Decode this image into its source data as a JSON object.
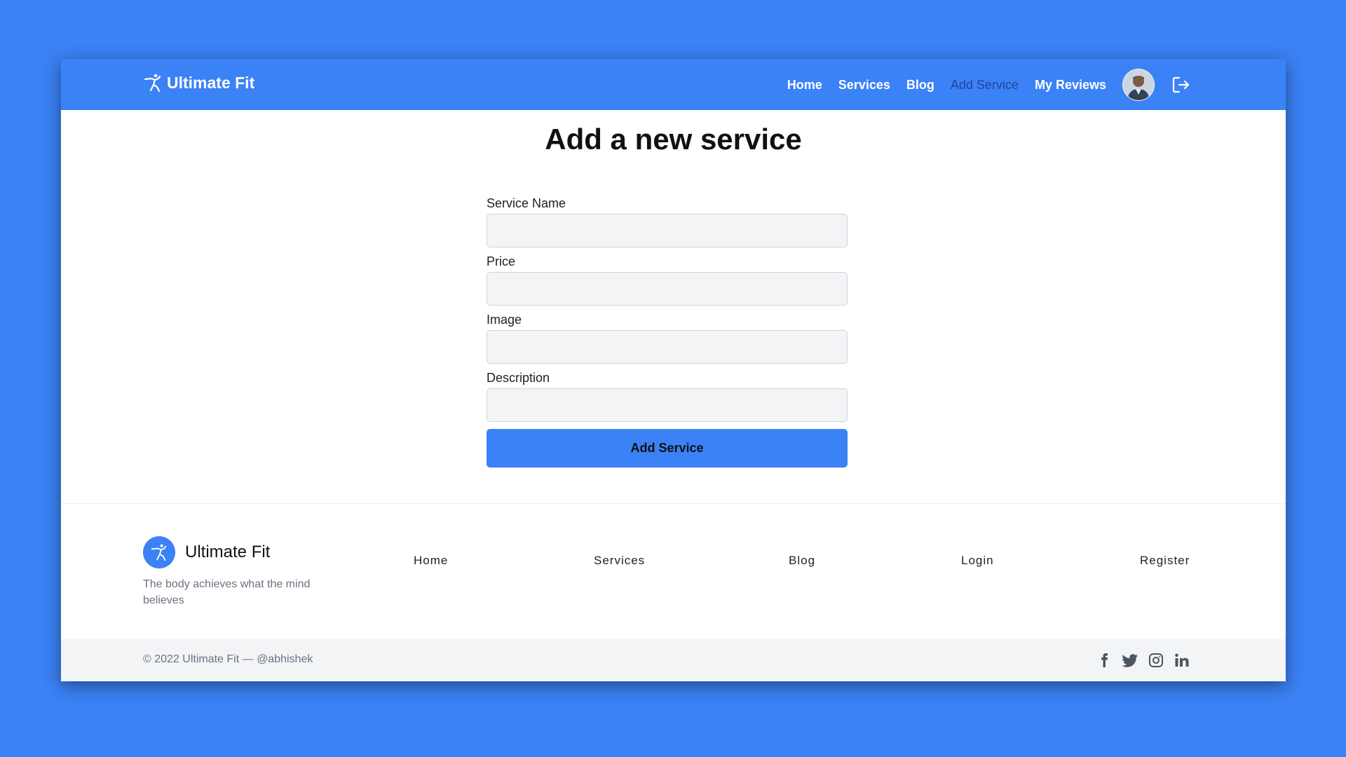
{
  "navbar": {
    "brand": "Ultimate Fit",
    "links": [
      {
        "label": "Home",
        "active": false
      },
      {
        "label": "Services",
        "active": false
      },
      {
        "label": "Blog",
        "active": false
      },
      {
        "label": "Add Service",
        "active": true
      },
      {
        "label": "My Reviews",
        "active": false
      }
    ],
    "avatar_icon": "user-avatar",
    "logout_icon": "logout-icon"
  },
  "main": {
    "title": "Add a new service",
    "fields": [
      {
        "label": "Service Name",
        "value": "",
        "placeholder": ""
      },
      {
        "label": "Price",
        "value": "",
        "placeholder": ""
      },
      {
        "label": "Image",
        "value": "",
        "placeholder": ""
      },
      {
        "label": "Description",
        "value": "",
        "placeholder": ""
      }
    ],
    "submit_label": "Add Service"
  },
  "footer": {
    "brand": "Ultimate Fit",
    "tagline": "The body achieves what the mind believes",
    "links": [
      "Home",
      "Services",
      "Blog",
      "Login",
      "Register"
    ],
    "copyright": "© 2022 Ultimate Fit — @abhishek",
    "socials": [
      "facebook-icon",
      "twitter-icon",
      "instagram-icon",
      "linkedin-icon"
    ]
  },
  "colors": {
    "brand": "#3b82f6",
    "active_nav": "#1e3a8a",
    "footer_bar": "#f3f4f6"
  }
}
